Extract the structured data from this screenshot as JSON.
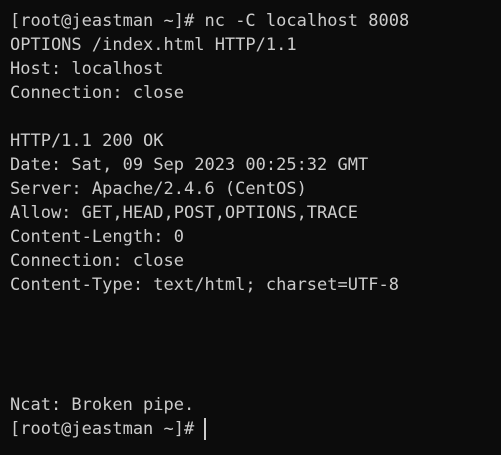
{
  "terminal": {
    "prompt": "[root@jeastman ~]#",
    "command": "nc -C localhost 8008",
    "request": [
      "OPTIONS /index.html HTTP/1.1",
      "Host: localhost",
      "Connection: close"
    ],
    "response": [
      "HTTP/1.1 200 OK",
      "Date: Sat, 09 Sep 2023 00:25:32 GMT",
      "Server: Apache/2.4.6 (CentOS)",
      "Allow: GET,HEAD,POST,OPTIONS,TRACE",
      "Content-Length: 0",
      "Connection: close",
      "Content-Type: text/html; charset=UTF-8"
    ],
    "error": "Ncat: Broken pipe.",
    "final_prompt": "[root@jeastman ~]#"
  },
  "colors": {
    "background": "#0c0c0c",
    "foreground": "#cccccc"
  }
}
